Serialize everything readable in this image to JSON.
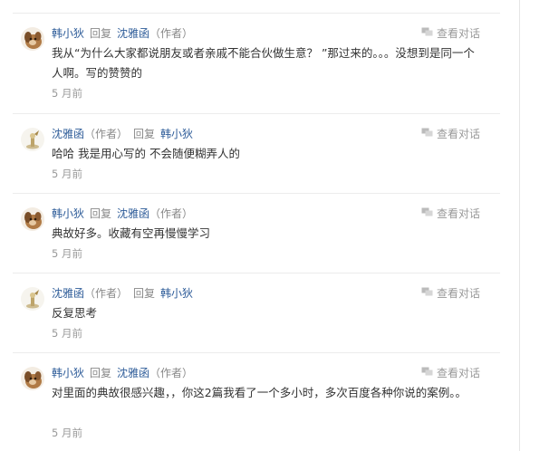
{
  "labels": {
    "reply": "回复",
    "author": "（作者）",
    "view_conversation": "查看对话"
  },
  "icons": {
    "conversation": "conversation-icon",
    "avatar_han": "avatar-dog-icon",
    "avatar_shen": "avatar-figurine-icon"
  },
  "colors": {
    "username": "#2e5c99",
    "meta": "#888888",
    "text": "#333333"
  },
  "comments": [
    {
      "author": "韩小狄",
      "author_tag": "",
      "reply_to": "沈雅函",
      "reply_to_tag": "（作者）",
      "text": "我从“为什么大家都说朋友或者亲戚不能合伙做生意？ ”那过来的。。。没想到是同一个人啊。写的赞赞的",
      "time": "5 月前"
    },
    {
      "author": "沈雅函",
      "author_tag": "（作者）",
      "reply_to": "韩小狄",
      "reply_to_tag": "",
      "text": "哈哈 我是用心写的 不会随便糊弄人的",
      "time": "5 月前"
    },
    {
      "author": "韩小狄",
      "author_tag": "",
      "reply_to": "沈雅函",
      "reply_to_tag": "（作者）",
      "text": "典故好多。收藏有空再慢慢学习",
      "time": "5 月前"
    },
    {
      "author": "沈雅函",
      "author_tag": "（作者）",
      "reply_to": "韩小狄",
      "reply_to_tag": "",
      "text": "反复思考",
      "time": "5 月前"
    },
    {
      "author": "韩小狄",
      "author_tag": "",
      "reply_to": "沈雅函",
      "reply_to_tag": "（作者）",
      "text": "对里面的典故很感兴趣，，你这2篇我看了一个多小时，多次百度各种你说的案例。。",
      "time": "5 月前"
    }
  ]
}
